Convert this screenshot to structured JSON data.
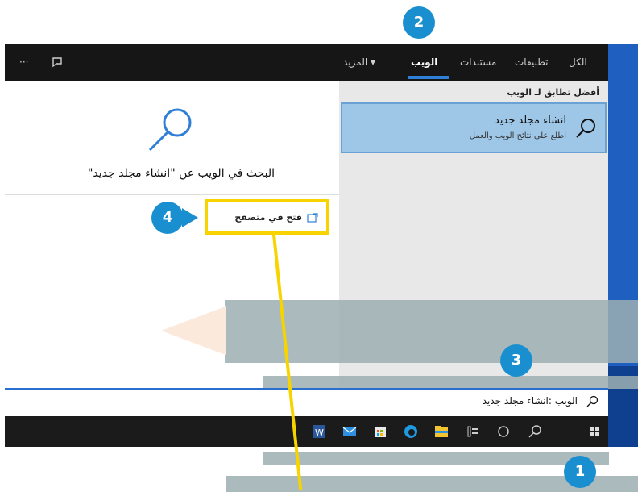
{
  "topbar": {
    "tabs": [
      "الكل",
      "تطبيقات",
      "مستندات",
      "الويب",
      "المزيد ▾"
    ],
    "active_tab": "الويب",
    "more_icon": "ellipsis-icon",
    "feedback_icon": "feedback-icon"
  },
  "results": {
    "section_title": "أفضل تطابق لـ الويب",
    "best_match_title": "انشاء مجلد جديد",
    "best_match_subtitle": "اطلع على نتائج الويب والعمل"
  },
  "preview": {
    "query": "البحث في الويب عن \"انشاء مجلد جديد\"",
    "open_in_browser": "فتح في متصفح"
  },
  "searchbox": {
    "value": "الويب :انشاء مجلد جديد"
  },
  "badges": {
    "b1": "1",
    "b2": "2",
    "b3": "3",
    "b4": "4"
  },
  "colors": {
    "accent": "#1a8fcf",
    "highlight": "#f7d400",
    "selected": "#9ec6e6"
  }
}
